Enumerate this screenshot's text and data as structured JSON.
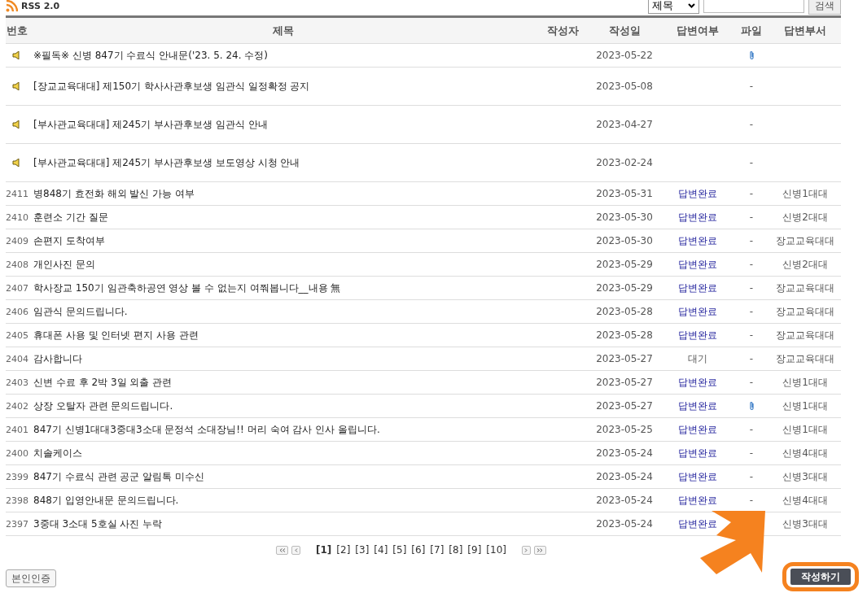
{
  "rss": {
    "label": "RSS 2.0"
  },
  "search": {
    "field": "제목",
    "button": "검색"
  },
  "table": {
    "columns": [
      "번호",
      "제목",
      "작성자",
      "작성일",
      "답변여부",
      "파일",
      "답변부서"
    ],
    "rows": [
      {
        "kind": "notice",
        "title": "※필독※ 신병 847기 수료식 안내문('23. 5. 24. 수정)",
        "date": "2023-05-22",
        "attachment": true
      },
      {
        "kind": "notice",
        "title": "[장교교육대대] 제150기 학사사관후보생 임관식 일정확정 공지",
        "date": "2023-05-08",
        "file": "-"
      },
      {
        "kind": "notice",
        "title": "[부사관교육대대] 제245기 부사관후보생 임관식 안내",
        "date": "2023-04-27",
        "file": "-"
      },
      {
        "kind": "notice",
        "title": "[부사관교육대대] 제245기 부사관후보생 보도영상 시청 안내",
        "date": "2023-02-24",
        "file": "-"
      },
      {
        "kind": "post",
        "number": "2411",
        "title": "병848기 효전화 해외 발신 가능 여부",
        "date": "2023-05-31",
        "status": "답변완료",
        "answered": true,
        "file": "-",
        "dept": "신병1대대"
      },
      {
        "kind": "post",
        "number": "2410",
        "title": "훈련소 기간 질문",
        "date": "2023-05-30",
        "status": "답변완료",
        "answered": true,
        "file": "-",
        "dept": "신병2대대"
      },
      {
        "kind": "post",
        "number": "2409",
        "title": "손편지 도착여부",
        "date": "2023-05-30",
        "status": "답변완료",
        "answered": true,
        "file": "-",
        "dept": "장교교육대대"
      },
      {
        "kind": "post",
        "number": "2408",
        "title": "개인사진 문의",
        "date": "2023-05-29",
        "status": "답변완료",
        "answered": true,
        "file": "-",
        "dept": "신병2대대"
      },
      {
        "kind": "post",
        "number": "2407",
        "title": "학사장교 150기 임관축하공연 영상 볼 수 없는지 여쭤봅니다__내용 無",
        "date": "2023-05-29",
        "status": "답변완료",
        "answered": true,
        "file": "-",
        "dept": "장교교육대대"
      },
      {
        "kind": "post",
        "number": "2406",
        "title": "임관식 문의드립니다.",
        "date": "2023-05-28",
        "status": "답변완료",
        "answered": true,
        "file": "-",
        "dept": "장교교육대대"
      },
      {
        "kind": "post",
        "number": "2405",
        "title": "휴대폰 사용 및 인터넷 편지 사용 관련",
        "date": "2023-05-28",
        "status": "답변완료",
        "answered": true,
        "file": "-",
        "dept": "장교교육대대"
      },
      {
        "kind": "post",
        "number": "2404",
        "title": "감사합니다",
        "date": "2023-05-27",
        "status": "대기",
        "answered": false,
        "file": "-",
        "dept": "장교교육대대"
      },
      {
        "kind": "post",
        "number": "2403",
        "title": "신변 수료 후 2박 3일 외출 관련",
        "date": "2023-05-27",
        "status": "답변완료",
        "answered": true,
        "file": "-",
        "dept": "신병1대대"
      },
      {
        "kind": "post",
        "number": "2402",
        "title": "상장 오탈자 관련 문의드립니다.",
        "date": "2023-05-27",
        "status": "답변완료",
        "answered": true,
        "attachment": true,
        "dept": "신병1대대"
      },
      {
        "kind": "post",
        "number": "2401",
        "title": "847기 신병1대대3중대3소대 문정석 소대장님!! 머리 숙여 감사 인사 올립니다.",
        "date": "2023-05-25",
        "status": "답변완료",
        "answered": true,
        "file": "-",
        "dept": "신병1대대"
      },
      {
        "kind": "post",
        "number": "2400",
        "title": "치솔케이스",
        "date": "2023-05-24",
        "status": "답변완료",
        "answered": true,
        "file": "-",
        "dept": "신병4대대"
      },
      {
        "kind": "post",
        "number": "2399",
        "title": "847기 수료식 관련 공군 알림톡 미수신",
        "date": "2023-05-24",
        "status": "답변완료",
        "answered": true,
        "file": "-",
        "dept": "신병3대대"
      },
      {
        "kind": "post",
        "number": "2398",
        "title": "848기 입영안내문 문의드립니다.",
        "date": "2023-05-24",
        "status": "답변완료",
        "answered": true,
        "file": "-",
        "dept": "신병4대대"
      },
      {
        "kind": "post",
        "number": "2397",
        "title": "3중대 3소대 5호실 사진 누락",
        "date": "2023-05-24",
        "status": "답변완료",
        "answered": true,
        "dept": "신병3대대"
      }
    ]
  },
  "pagination": {
    "pages": [
      {
        "label": "[1]",
        "selected": true
      },
      {
        "label": "[2]",
        "selected": false
      },
      {
        "label": "[3]",
        "selected": false
      },
      {
        "label": "[4]",
        "selected": false
      },
      {
        "label": "[5]",
        "selected": false
      },
      {
        "label": "[6]",
        "selected": false
      },
      {
        "label": "[7]",
        "selected": false
      },
      {
        "label": "[8]",
        "selected": false
      },
      {
        "label": "[9]",
        "selected": false
      },
      {
        "label": "[10]",
        "selected": false
      }
    ]
  },
  "buttons": {
    "verify": "본인인증",
    "write": "작성하기"
  }
}
